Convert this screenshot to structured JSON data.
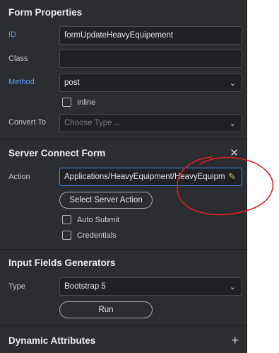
{
  "form_properties": {
    "title": "Form Properties",
    "id_label": "ID",
    "id_value": "formUpdateHeavyEquipement",
    "class_label": "Class",
    "class_value": "",
    "method_label": "Method",
    "method_value": "post",
    "inline_label": "Inline",
    "convert_label": "Convert To",
    "convert_placeholder": "Choose Type ..."
  },
  "server_connect": {
    "title": "Server Connect Form",
    "close_icon": "close-icon",
    "action_label": "Action",
    "action_value": "Applications/HeavyEquipment/HeavyEquipmentE",
    "select_action_button": "Select Server Action",
    "auto_submit_label": "Auto Submit",
    "credentials_label": "Credentials"
  },
  "input_fields": {
    "title": "Input Fields Generators",
    "type_label": "Type",
    "type_value": "Bootstrap 5",
    "run_button": "Run"
  },
  "dynamic_attributes": {
    "title": "Dynamic Attributes",
    "add_icon": "plus-icon"
  },
  "colors": {
    "panel_bg": "#2b2d30",
    "accent_blue": "#3b8df0",
    "label_blue": "#5aa0ff",
    "annotation_red": "#e02020"
  }
}
